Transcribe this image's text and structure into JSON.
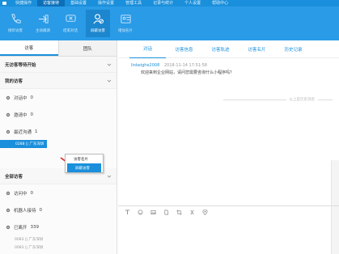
{
  "topnav": {
    "items": [
      "快捷操作",
      "访客接待",
      "基础设置",
      "操作设置",
      "管理工具",
      "记录与统计",
      "个人设置",
      "帮助中心"
    ]
  },
  "toolbar": {
    "items": [
      {
        "label": "接听访客",
        "icon": "phone-icon"
      },
      {
        "label": "主动邀请",
        "icon": "invite-icon"
      },
      {
        "label": "结束对话",
        "icon": "end-chat-icon"
      },
      {
        "label": "屏蔽访客",
        "icon": "block-visitor-icon"
      },
      {
        "label": "增加名片",
        "icon": "add-card-icon"
      }
    ]
  },
  "left": {
    "tabs": [
      "访客",
      "团队"
    ],
    "section_no_wait": "无访客等待开始",
    "section_my": "我的访客",
    "rows_my": [
      {
        "label": "对话中",
        "count": "0"
      },
      {
        "label": "邀请中",
        "count": "0"
      },
      {
        "label": "最近沟通",
        "count": "1"
      }
    ],
    "selected_item": "0288 || 广东深圳",
    "section_all": "全部访客",
    "rows_all": [
      {
        "label": "访问中",
        "count": "0"
      },
      {
        "label": "机器人接待",
        "count": "0"
      },
      {
        "label": "已离开",
        "count": "339"
      }
    ],
    "sub_items": [
      "0083 || 广东深圳",
      "0083 || 广东深圳"
    ]
  },
  "context_menu": {
    "items": [
      "访客名片",
      "屏蔽访客"
    ]
  },
  "right": {
    "tabs": [
      "对话",
      "访客信息",
      "访客轨迹",
      "访客名片",
      "历史记录"
    ],
    "msg_sender": "linkeighe2008",
    "msg_time": "2018-11-14 17:51:58",
    "msg_text": "欢迎来到企业网站，请问您需要咨询什么小程序吗？",
    "divider_text": "以上是历史消息"
  },
  "colors": {
    "primary": "#1a8fdb",
    "toolbar": "#2a9be6"
  }
}
